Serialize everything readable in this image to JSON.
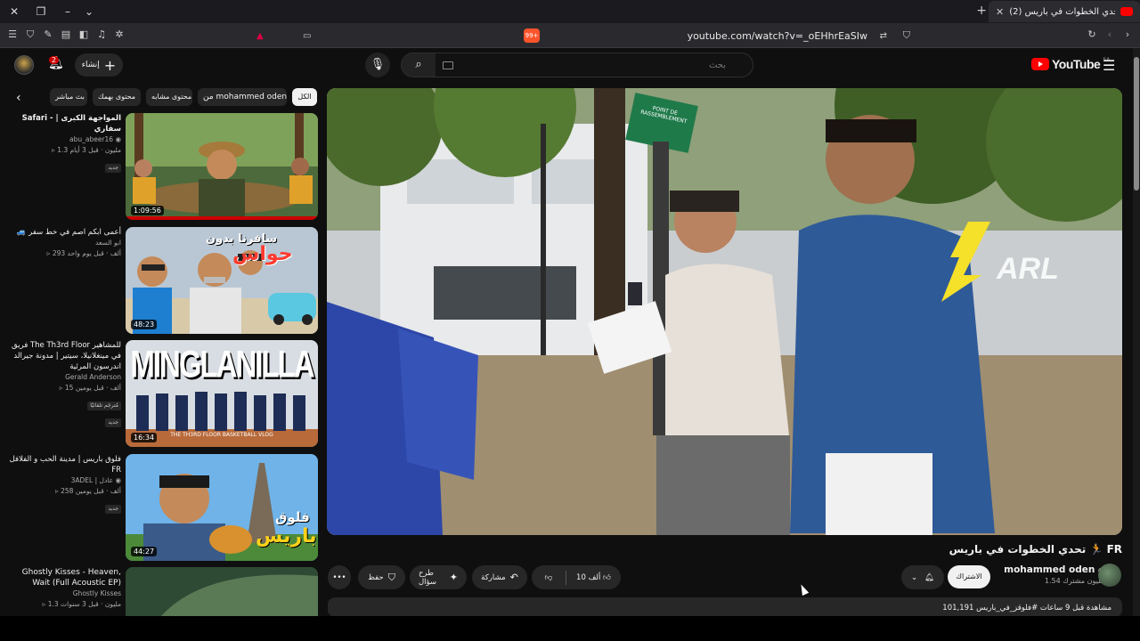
{
  "browser": {
    "tab_title": "(2) تحدي الخطوات في باريس 🏃",
    "url": "youtube.com/watch?v=_oEHhrEaSIw",
    "brave_badge": "99+"
  },
  "header": {
    "notification_count": "2",
    "create_label": "إنشاء",
    "search_placeholder": "بحث",
    "logo_text": "YouTube",
    "logo_region": "SA"
  },
  "chips": [
    {
      "label": "الكل",
      "active": true
    },
    {
      "label": "من mohammed oden",
      "active": false
    },
    {
      "label": "محتوى مشابه",
      "active": false
    },
    {
      "label": "محتوى بهمك",
      "active": false
    },
    {
      "label": "بث مباشر",
      "active": false
    }
  ],
  "recommendations": [
    {
      "title": "Safari - المواجهة الكبرى | سفاري",
      "channel": "abu_abeer16",
      "stats": "1.3 مليون · قبل 3 أيام",
      "badge": "جديد",
      "duration": "1:09:56"
    },
    {
      "title": "🚙 أعمى ابكم اصم في خط سفر",
      "channel": "ابو السعد",
      "stats": "293 ألف · قبل يوم واحد",
      "badge": "جديد",
      "duration": "48:23"
    },
    {
      "title": "فريق The Th3rd Floor للمشاهير في مينغلانيلا، سيتير | مدونة جيرالد اندرسون المرئية",
      "channel": "Gerald Anderson",
      "stats": "15 ألف · قبل يومين",
      "badge_extra": "مُترجَم تلقائيًا",
      "badge": "جديد",
      "duration": "16:34"
    },
    {
      "title": "فلوق باريس | مدينة الحب و الفلافل FR",
      "channel": "3ADEL | عادل",
      "stats": "258 ألف · قبل يومين",
      "badge": "جديد",
      "duration": "44:27"
    },
    {
      "title": "Ghostly Kisses - Heaven, Wait (Full Acoustic EP)",
      "channel": "Ghostly Kisses",
      "stats": "1.3 مليون · قبل 3 سنوات",
      "badge": "",
      "duration": ""
    }
  ],
  "thumb_texts": {
    "t2_line1": "سافرنا بدون",
    "t2_line2": "حواس",
    "t3_big": "MINGLANILLA",
    "t3_sub": "THE TH3RD FLOOR BASKETBALL VLOG",
    "t4_line1": "فلوق",
    "t4_line2": "باريس"
  },
  "video": {
    "title": "تحدي الخطوات في باريس 🏃 FR",
    "sign_text": "POINT DE RASSEMBLEMENT",
    "watermark": "ARL",
    "channel_name": "mohammed oden",
    "channel_subs": "1.54 مليون مشترك",
    "subscribe_label": "الاشتراك",
    "like_count": "10 ألف",
    "share_label": "مشاركة",
    "ask_label": "طرح سؤال",
    "save_label": "حفظ",
    "description": "101,191 مشاهدة قبل 9 ساعات #فلوقز_في_باريس"
  }
}
